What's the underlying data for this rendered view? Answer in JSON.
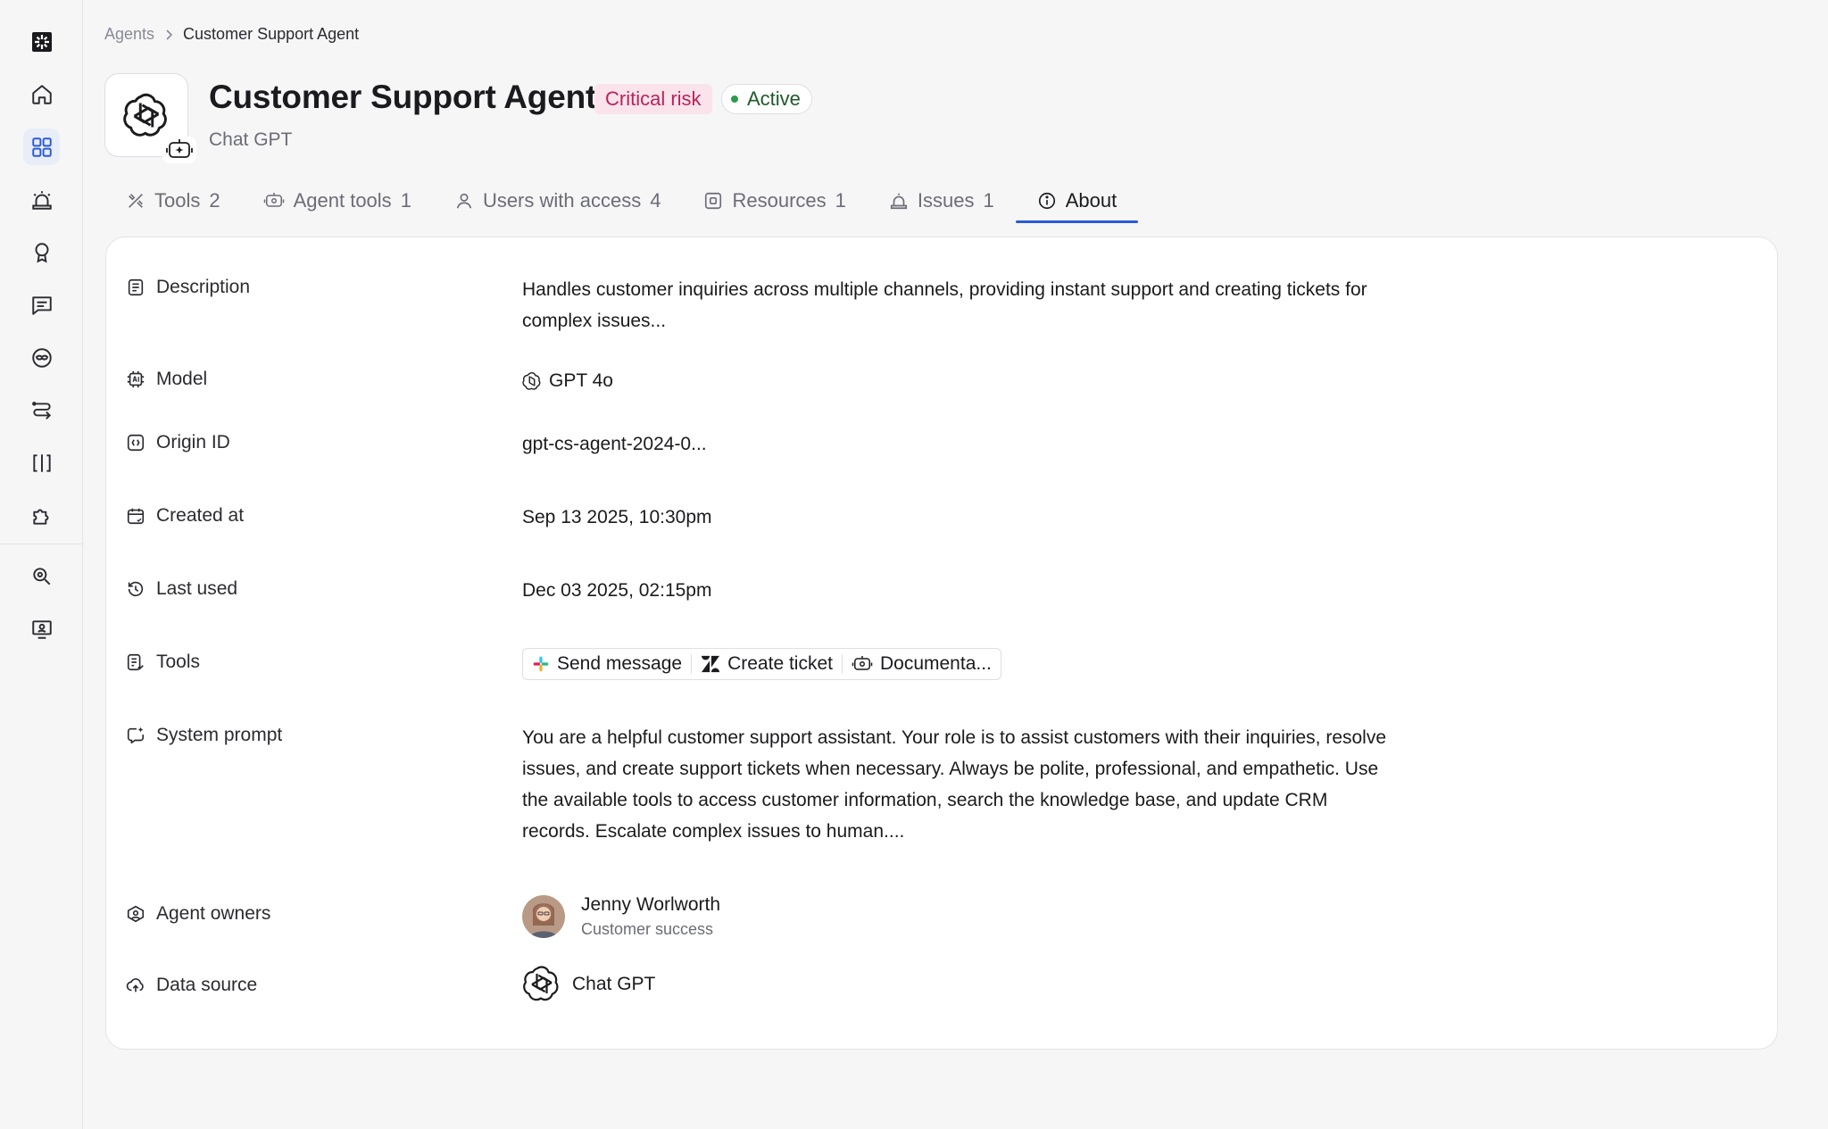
{
  "sidebar": {
    "items": [
      {
        "icon": "brand-logo-icon"
      },
      {
        "icon": "home-icon"
      },
      {
        "icon": "grid-icon",
        "active": true
      },
      {
        "icon": "alarm-icon"
      },
      {
        "icon": "award-icon"
      },
      {
        "icon": "message-icon"
      },
      {
        "icon": "mask-icon"
      },
      {
        "icon": "flow-icon"
      },
      {
        "icon": "brackets-icon"
      },
      {
        "icon": "puzzle-icon"
      },
      {
        "icon": "search-settings-icon"
      },
      {
        "icon": "monitor-user-icon"
      }
    ]
  },
  "breadcrumb": {
    "root": "Agents",
    "current": "Customer Support Agent"
  },
  "header": {
    "title": "Customer Support Agent",
    "risk_badge": "Critical risk",
    "status_badge": "Active",
    "subtitle": "Chat GPT"
  },
  "tabs": [
    {
      "label": "Tools",
      "count": "2",
      "icon": "tools-icon"
    },
    {
      "label": "Agent tools",
      "count": "1",
      "icon": "agent-icon"
    },
    {
      "label": "Users with access",
      "count": "4",
      "icon": "user-icon"
    },
    {
      "label": "Resources",
      "count": "1",
      "icon": "resource-icon"
    },
    {
      "label": "Issues",
      "count": "1",
      "icon": "alarm-icon"
    },
    {
      "label": "About",
      "count": "",
      "icon": "info-icon",
      "active": true
    }
  ],
  "about": {
    "description": {
      "label": "Description",
      "value": "Handles customer inquiries across multiple channels, providing instant support and creating tickets for complex issues..."
    },
    "model": {
      "label": "Model",
      "value": "GPT 4o"
    },
    "origin_id": {
      "label": "Origin ID",
      "value": "gpt-cs-agent-2024-0..."
    },
    "created_at": {
      "label": "Created at",
      "value": "Sep 13 2025, 10:30pm"
    },
    "last_used": {
      "label": "Last used",
      "value": "Dec 03 2025, 02:15pm"
    },
    "tools": {
      "label": "Tools",
      "items": [
        "Send message",
        "Create ticket",
        "Documenta..."
      ]
    },
    "system_prompt": {
      "label": "System prompt",
      "value": "You are a helpful customer support assistant. Your role is to assist customers with their inquiries, resolve issues, and create support tickets when necessary. Always be polite, professional, and empathetic. Use the available tools to access customer information, search the knowledge base, and update CRM records. Escalate complex issues to human...."
    },
    "owners": {
      "label": "Agent owners",
      "name": "Jenny Worlworth",
      "role": "Customer success"
    },
    "data_source": {
      "label": "Data source",
      "value": "Chat GPT"
    }
  },
  "colors": {
    "accent": "#2a5bd7",
    "risk_bg": "#fbe3ec",
    "risk_text": "#b8245a",
    "active_dot": "#2e9a4b"
  }
}
